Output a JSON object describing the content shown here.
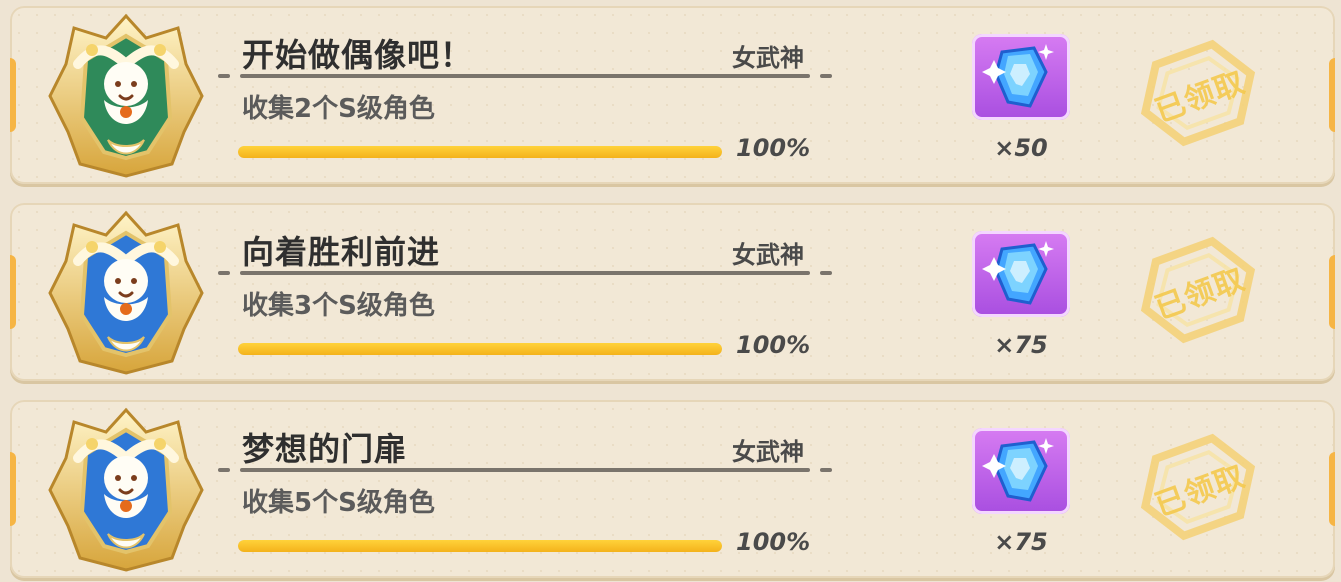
{
  "achievements": [
    {
      "title": "开始做偶像吧！",
      "tag": "女武神",
      "description": "收集2个S级角色",
      "progress_fraction": 1.0,
      "progress_label": "100%",
      "reward_icon": "blue-crystal-icon",
      "reward_count": "×50",
      "status_stamp": "已领取",
      "badge_color": "#2f8a5a"
    },
    {
      "title": "向着胜利前进",
      "tag": "女武神",
      "description": "收集3个S级角色",
      "progress_fraction": 1.0,
      "progress_label": "100%",
      "reward_icon": "blue-crystal-icon",
      "reward_count": "×75",
      "status_stamp": "已领取",
      "badge_color": "#2f78d6"
    },
    {
      "title": "梦想的门扉",
      "tag": "女武神",
      "description": "收集5个S级角色",
      "progress_fraction": 1.0,
      "progress_label": "100%",
      "reward_icon": "blue-crystal-icon",
      "reward_count": "×75",
      "status_stamp": "已领取",
      "badge_color": "#2f78d6"
    }
  ],
  "colors": {
    "progress": "#f4b21b",
    "reward_bg": "#b85fe6",
    "stamp": "#f4c94e"
  }
}
